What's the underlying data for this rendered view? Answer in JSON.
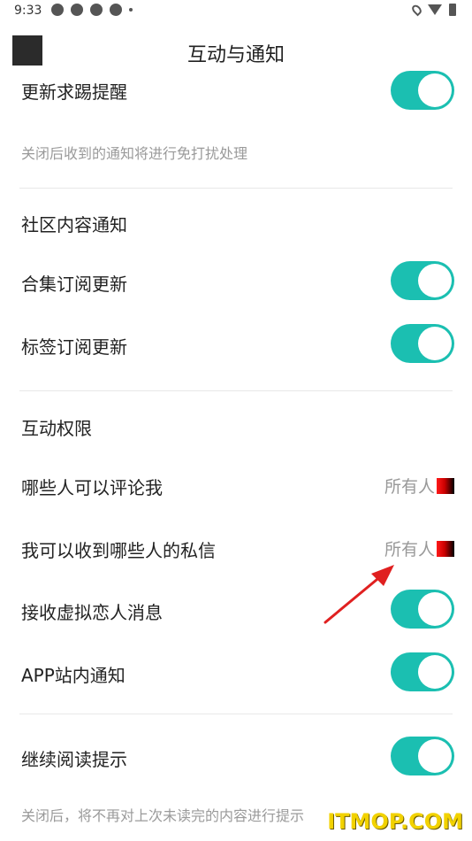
{
  "status_bar": {
    "time": "9:33"
  },
  "header": {
    "title": "互动与通知"
  },
  "sections": {
    "update_reminder": {
      "label": "更新求踢提醒",
      "enabled": true,
      "hint": "关闭后收到的通知将进行免打扰处理"
    },
    "community": {
      "title": "社区内容通知",
      "items": [
        {
          "label": "合集订阅更新",
          "enabled": true
        },
        {
          "label": "标签订阅更新",
          "enabled": true
        }
      ]
    },
    "permissions": {
      "title": "互动权限",
      "items": [
        {
          "label": "哪些人可以评论我",
          "value": "所有人"
        },
        {
          "label": "我可以收到哪些人的私信",
          "value": "所有人"
        }
      ],
      "toggles": [
        {
          "label": "接收虚拟恋人消息",
          "enabled": true
        },
        {
          "label": "APP站内通知",
          "enabled": true
        }
      ]
    },
    "reading": {
      "label": "继续阅读提示",
      "enabled": true,
      "hint": "关闭后，将不再对上次未读完的内容进行提示"
    }
  },
  "colors": {
    "toggle_on": "#1bbfb1",
    "annotation_arrow": "#e02020"
  },
  "watermark": {
    "text": "ITMOP.COM"
  }
}
